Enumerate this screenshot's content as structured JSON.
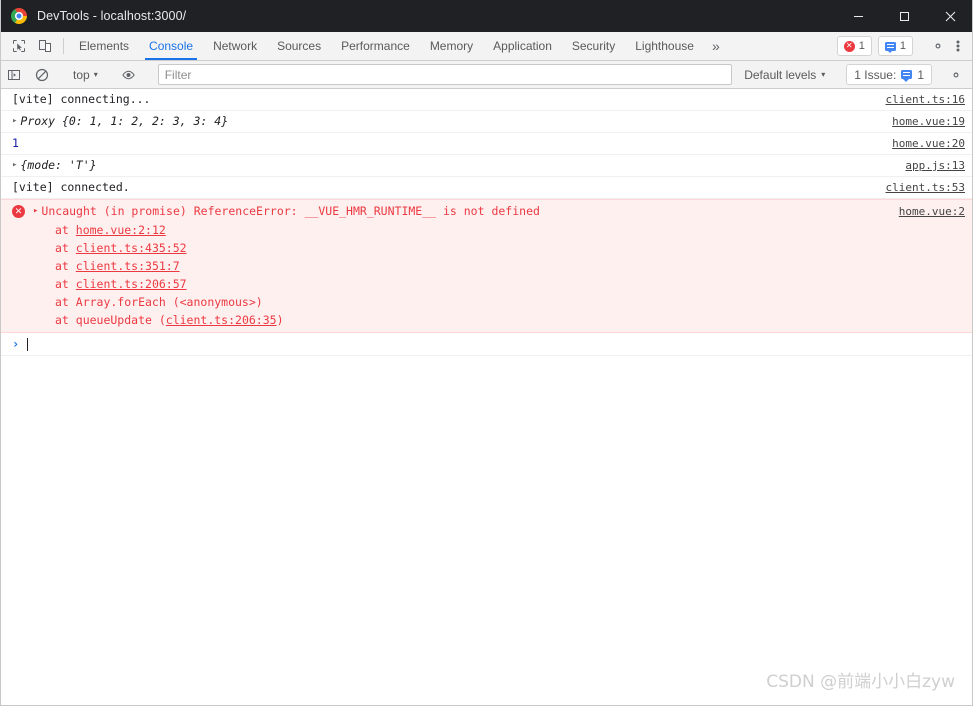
{
  "window": {
    "title": "DevTools - localhost:3000/",
    "logo_icon": "chrome-logo-icon",
    "minimize_label": "—",
    "maximize_label": "☐",
    "close_label": "✕"
  },
  "tabstrip": {
    "inspect_icon": "inspect-element-icon",
    "device_icon": "device-toolbar-icon",
    "tabs": [
      {
        "label": "Elements",
        "active": false
      },
      {
        "label": "Console",
        "active": true
      },
      {
        "label": "Network",
        "active": false
      },
      {
        "label": "Sources",
        "active": false
      },
      {
        "label": "Performance",
        "active": false
      },
      {
        "label": "Memory",
        "active": false
      },
      {
        "label": "Application",
        "active": false
      },
      {
        "label": "Security",
        "active": false
      },
      {
        "label": "Lighthouse",
        "active": false
      }
    ],
    "more_label": "»",
    "error_badge": {
      "icon": "error-circle-icon",
      "count": "1"
    },
    "message_badge": {
      "icon": "message-icon",
      "count": "1"
    },
    "settings_icon": "gear-icon",
    "menu_icon": "kebab-menu-icon"
  },
  "consolebar": {
    "sidebar_icon": "console-sidebar-icon",
    "clear_icon": "clear-console-icon",
    "context": "top",
    "context_caret": "▾",
    "eye_icon": "live-expression-eye-icon",
    "filter_placeholder": "Filter",
    "filter_value": "",
    "levels_label": "Default levels",
    "levels_caret": "▾",
    "issues_label": "1 Issue:",
    "issues_icon": "message-icon",
    "issues_count": "1",
    "settings_icon": "gear-icon"
  },
  "console": {
    "rows": [
      {
        "expand": "",
        "text": "[vite] connecting...",
        "source": "client.ts:16"
      },
      {
        "expand": "▸",
        "text": "Proxy {0: 1, 1: 2, 2: 3, 3: 4}",
        "source": "home.vue:19"
      },
      {
        "expand": "",
        "text": "1",
        "source": "home.vue:20"
      },
      {
        "expand": "▸",
        "text": "{mode: 'T'}",
        "source": "app.js:13"
      },
      {
        "expand": "",
        "text": "[vite] connected.",
        "source": "client.ts:53"
      }
    ],
    "error": {
      "icon": "error-circle-icon",
      "expand": "▸",
      "message": "Uncaught (in promise) ReferenceError: __VUE_HMR_RUNTIME__ is not defined",
      "source": "home.vue:2",
      "stack": [
        {
          "prefix": "at ",
          "link": "home.vue:2:12",
          "suffix": ""
        },
        {
          "prefix": "at ",
          "link": "client.ts:435:52",
          "suffix": ""
        },
        {
          "prefix": "at ",
          "link": "client.ts:351:7",
          "suffix": ""
        },
        {
          "prefix": "at ",
          "link": "client.ts:206:57",
          "suffix": ""
        },
        {
          "prefix": "at Array.forEach (<anonymous>)",
          "link": "",
          "suffix": ""
        },
        {
          "prefix": "at queueUpdate (",
          "link": "client.ts:206:35",
          "suffix": ")"
        }
      ]
    },
    "prompt": {
      "caret": "›",
      "value": ""
    }
  },
  "watermark": "CSDN @前端小小白zyw",
  "colors": {
    "titlebar_bg": "#202124",
    "accent": "#1a73e8",
    "error": "#eb3941",
    "error_bg": "#fff0f0",
    "toolbar_bg": "#f3f3f3"
  }
}
